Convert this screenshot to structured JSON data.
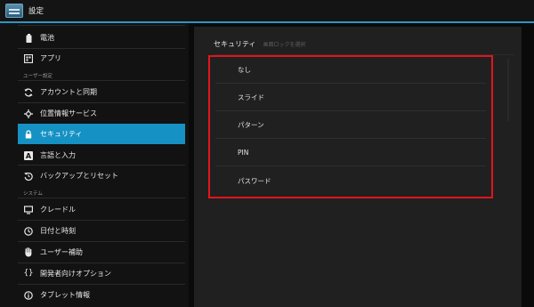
{
  "window": {
    "title": "設定"
  },
  "sidebar": {
    "items": [
      {
        "label": "電池",
        "icon": "battery-icon"
      },
      {
        "label": "アプリ",
        "icon": "apps-icon"
      },
      {
        "label": "アカウントと同期",
        "icon": "sync-icon"
      },
      {
        "label": "位置情報サービス",
        "icon": "location-icon"
      },
      {
        "label": "セキュリティ",
        "icon": "lock-icon",
        "active": true
      },
      {
        "label": "言語と入力",
        "icon": "keyboard-icon"
      },
      {
        "label": "バックアップとリセット",
        "icon": "backup-icon"
      },
      {
        "label": "クレードル",
        "icon": "monitor-icon"
      },
      {
        "label": "日付と時刻",
        "icon": "clock-icon"
      },
      {
        "label": "ユーザー補助",
        "icon": "hand-icon"
      },
      {
        "label": "開発者向けオプション",
        "icon": "braces-icon"
      },
      {
        "label": "タブレット情報",
        "icon": "info-icon"
      }
    ],
    "headers": {
      "user_settings": "ユーザー設定",
      "system": "システム"
    }
  },
  "main": {
    "breadcrumb": {
      "section": "セキュリティ",
      "page": "画面ロックを選択"
    },
    "options": [
      "なし",
      "スライド",
      "パターン",
      "PIN",
      "パスワード"
    ]
  },
  "colors": {
    "accent": "#1591c3",
    "highlight_border": "#e3141c",
    "title_rule": "#2f93c4"
  }
}
